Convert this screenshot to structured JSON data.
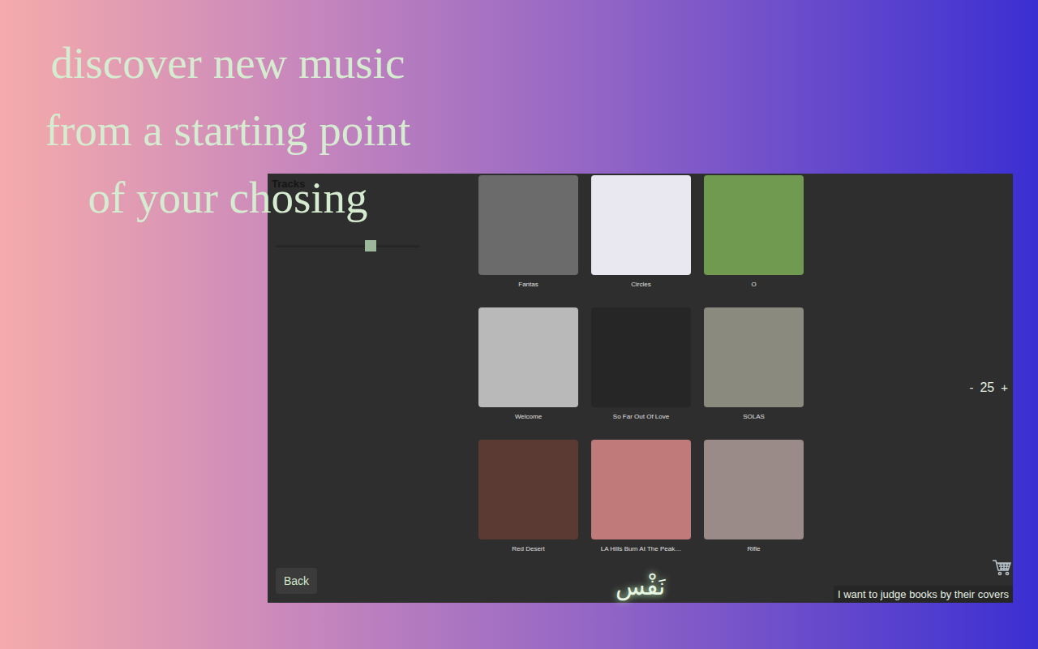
{
  "headline": [
    "discover new music",
    "from a starting point",
    "of your chosing"
  ],
  "panel": {
    "title": "Tracks",
    "slider": {
      "level": 0.67
    }
  },
  "tracks": [
    {
      "title": "Fantas",
      "color": "#6b6b6b"
    },
    {
      "title": "Circles",
      "color": "#e9e7ef"
    },
    {
      "title": "O",
      "color": "#6f9a4f"
    },
    {
      "title": "Welcome",
      "color": "#b9b9b9"
    },
    {
      "title": "So Far Out Of Love",
      "color": "#262626"
    },
    {
      "title": "SOLAS",
      "color": "#8a8a7e"
    },
    {
      "title": "Red Desert",
      "color": "#5b3a34"
    },
    {
      "title": "LA Hills Burn At The Peak…",
      "color": "#c07a7a"
    },
    {
      "title": "Rifle",
      "color": "#9a8a88"
    }
  ],
  "counter": {
    "minus": "-",
    "value": "25",
    "plus": "+"
  },
  "back": "Back",
  "logo": "نَفْس",
  "judge_link": "I want to judge books by their covers"
}
